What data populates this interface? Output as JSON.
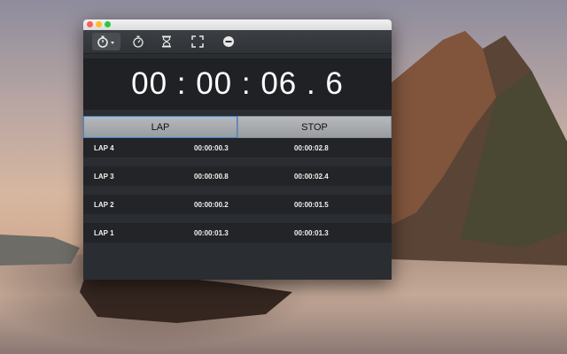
{
  "toolbar": {
    "icons": [
      "stopwatch-icon",
      "timer-icon",
      "hourglass-icon",
      "fullscreen-icon",
      "minus-circle-icon"
    ]
  },
  "display": {
    "time": "00 : 00 : 06 . 6"
  },
  "buttons": {
    "lap_label": "LAP",
    "stop_label": "STOP"
  },
  "laps": [
    {
      "name": "LAP 4",
      "split": "00:00:00.3",
      "total": "00:00:02.8"
    },
    {
      "name": "LAP 3",
      "split": "00:00:00.8",
      "total": "00:00:02.4"
    },
    {
      "name": "LAP 2",
      "split": "00:00:00.2",
      "total": "00:00:01.5"
    },
    {
      "name": "LAP 1",
      "split": "00:00:01.3",
      "total": "00:00:01.3"
    }
  ],
  "colors": {
    "lap_focus": "#3f86d6",
    "window_bg": "#2a2d31",
    "close": "#fc5f57",
    "minimize": "#fdbc2e",
    "zoom": "#29c840"
  }
}
